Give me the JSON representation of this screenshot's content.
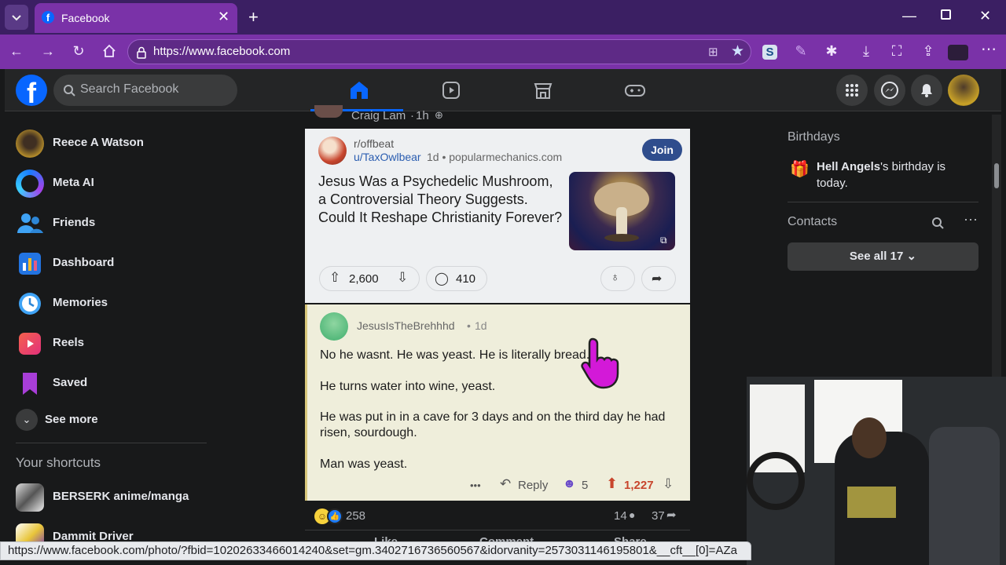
{
  "browser": {
    "tab_title": "Facebook",
    "url": "https://www.facebook.com",
    "status_url": "https://www.facebook.com/photo/?fbid=10202633466014240&set=gm.3402716736560567&idorvanity=2573031146195801&__cft__[0]=AZa"
  },
  "fb": {
    "search_placeholder": "Search Facebook",
    "sidebar": [
      {
        "label": "Reece A Watson",
        "icon": "profile-avatar"
      },
      {
        "label": "Meta AI",
        "icon": "meta-ai-icon"
      },
      {
        "label": "Friends",
        "icon": "friends-icon"
      },
      {
        "label": "Dashboard",
        "icon": "dashboard-icon"
      },
      {
        "label": "Memories",
        "icon": "memories-icon"
      },
      {
        "label": "Reels",
        "icon": "reels-icon"
      },
      {
        "label": "Saved",
        "icon": "saved-icon"
      }
    ],
    "see_more": "See more",
    "shortcuts_title": "Your shortcuts",
    "shortcuts": [
      {
        "label": "BERSERK anime/manga"
      },
      {
        "label": "Dammit Driver"
      }
    ]
  },
  "post": {
    "header_author": "Craig Lam",
    "header_time": "1h",
    "reddit": {
      "subreddit": "r/offbeat",
      "user": "u/TaxOwlbear",
      "meta": "1d • popularmechanics.com",
      "join_label": "Join",
      "headline": "Jesus Was a Psychedelic Mushroom, a Controversial Theory Suggests. Could It Reshape Christianity Forever?",
      "upvotes": "2,600",
      "comments": "410"
    },
    "comment": {
      "user": "JesusIsTheBrehhhd",
      "time": "1d",
      "lines": [
        "No he wasnt. He was yeast. He is literally bread.",
        "He turns water into wine, yeast.",
        "He was put in in a cave for 3 days and on the third day he had risen, sourdough.",
        "Man was yeast."
      ],
      "more": "•••",
      "reply": "Reply",
      "award_count": "5",
      "score": "1,227"
    },
    "reactions_count": "258",
    "comments_count": "14",
    "shares_count": "37",
    "actions": [
      "Like",
      "Comment",
      "Share"
    ]
  },
  "right": {
    "birthdays_title": "Birthdays",
    "birthday_name": "Hell Angels",
    "birthday_rest": "'s birthday is today.",
    "contacts_title": "Contacts",
    "see_all": "See all 17"
  },
  "colors": {
    "accent": "#7a32a8",
    "fb_blue": "#0866ff",
    "reddit_upvote": "#c8452c"
  }
}
